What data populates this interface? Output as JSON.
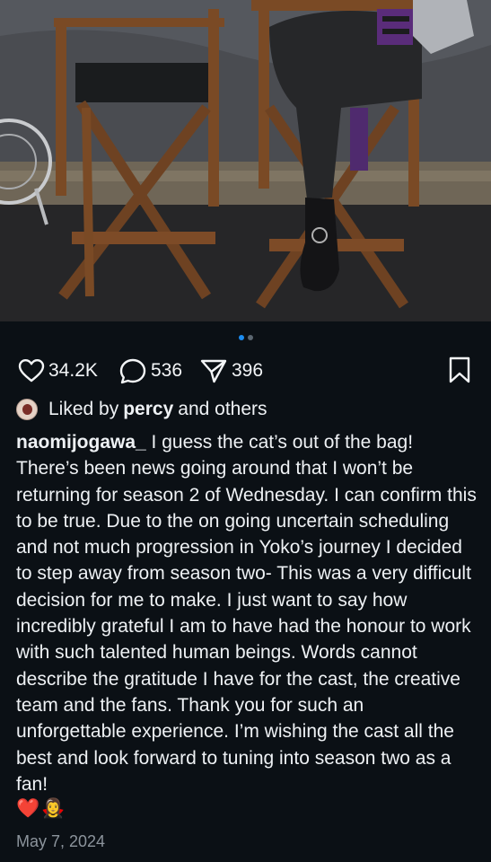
{
  "post": {
    "likes_count": "34.2K",
    "comments_count": "536",
    "shares_count": "396",
    "liked_by_prefix": "Liked by",
    "liked_by_user": "percy",
    "liked_by_suffix": "and others",
    "username": "naomijogawa_",
    "caption": "I guess the cat’s out of the bag! There’s been news going around that I won’t be returning for season 2 of Wednesday. I can confirm this to be true. Due to the on going uncertain scheduling and not much progression in Yoko’s journey I decided to step away from season two- This was a very difficult decision for me to make. I just want to say how incredibly grateful I am to have had the honour to work with such talented human beings. Words cannot describe the gratitude I have for the cast, the creative team and the fans. Thank you for such an unforgettable experience. I’m wishing the cast all the best and look forward to tuning into season two as a fan!",
    "emoji_1": "❤️",
    "emoji_2": "🧛‍♀️",
    "date": "May 7, 2024"
  },
  "carousel": {
    "count": 2,
    "active": 1
  }
}
